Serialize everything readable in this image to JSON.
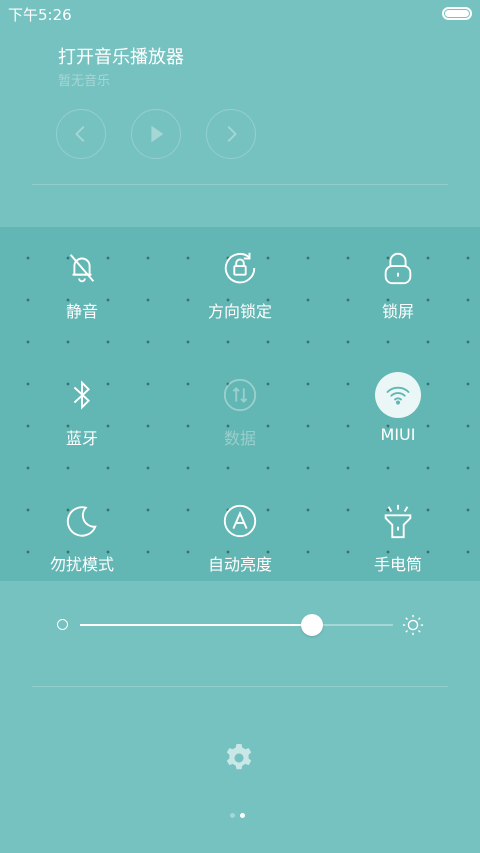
{
  "status_bar": {
    "time": "下午5:26",
    "battery_level": 1.0
  },
  "music": {
    "title": "打开音乐播放器",
    "subtitle": "暂无音乐",
    "prev_icon": "chevron-left-icon",
    "play_icon": "play-icon",
    "next_icon": "chevron-right-icon"
  },
  "toggles": [
    {
      "label": "静音",
      "icon": "bell-off-icon",
      "state": "off"
    },
    {
      "label": "方向锁定",
      "icon": "rotation-lock-icon",
      "state": "off"
    },
    {
      "label": "锁屏",
      "icon": "lock-icon",
      "state": "off"
    },
    {
      "label": "蓝牙",
      "icon": "bluetooth-icon",
      "state": "off"
    },
    {
      "label": "数据",
      "icon": "mobile-data-icon",
      "state": "disabled"
    },
    {
      "label": "MIUI",
      "icon": "wifi-icon",
      "state": "on"
    },
    {
      "label": "勿扰模式",
      "icon": "moon-icon",
      "state": "off"
    },
    {
      "label": "自动亮度",
      "icon": "auto-brightness-icon",
      "state": "off"
    },
    {
      "label": "手电筒",
      "icon": "flashlight-icon",
      "state": "off"
    }
  ],
  "brightness": {
    "level": 0.74
  },
  "pager": {
    "count": 2,
    "current": 2
  },
  "colors": {
    "background": "#76c2c0",
    "toggle_panel": "#62b6b3",
    "active_toggle_bg": "#eaf7f6",
    "active_icon": "#62b6b3"
  }
}
